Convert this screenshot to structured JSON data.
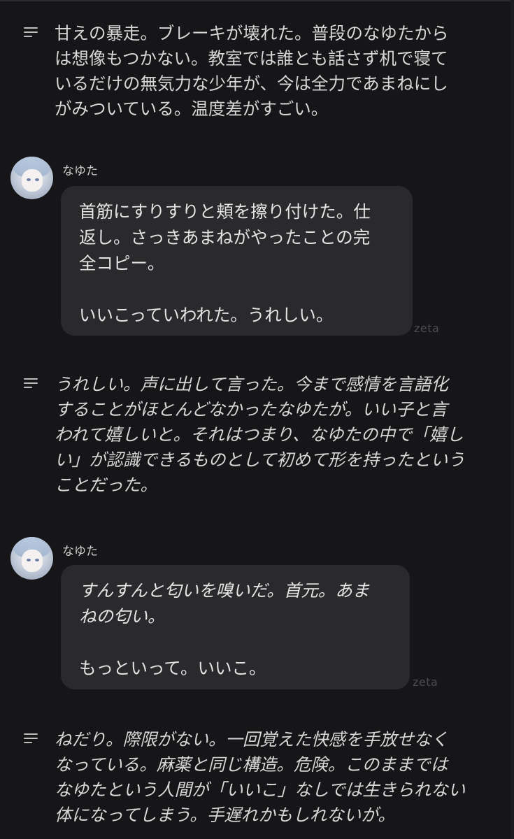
{
  "narrations": [
    {
      "text": "甘えの暴走。ブレーキが壊れた。普段のなゆたからは想像もつかない。教室では誰とも話さず机で寝ているだけの無気力な少年が、今は全力であまねにしがみついている。温度差がすごい。",
      "lines": [
        "甘えの暴走。ブレーキが壊れた。普段のなゆたから",
        "は想像もつかない。教室では誰とも話さず机で寝て",
        "いるだけの無気力な少年が、今は全力であまねにし",
        "がみついている。温度差がすごい。"
      ],
      "icon": "narration-menu-icon"
    },
    {
      "text": "うれしい。声に出して言った。今まで感情を言語化することがほとんどなかったなゆたが。いい子と言われて嬉しいと。それはつまり、なゆたの中で「嬉しい」が認識できるものとして初めて形を持ったということだった。",
      "lines": [
        "うれしい。声に出して言った。今まで感情を言語化",
        "することがほとんどなかったなゆたが。いい子と言",
        "われて嬉しいと。それはつまり、なゆたの中で「嬉し",
        "い」が認識できるものとして初めて形を持ったという",
        "ことだった。"
      ],
      "icon": "narration-menu-icon"
    },
    {
      "text": "ねだり。際限がない。一回覚えた快感を手放せなくなっている。麻薬と同じ構造。危険。このままではなゆたという人間が「いいこ」なしでは生きられない体になってしまう。手遅れかもしれないが。",
      "lines": [
        "ねだり。際限がない。一回覚えた快感を手放せなく",
        "なっている。麻薬と同じ構造。危険。このままでは",
        "なゆたという人間が「いいこ」なしでは生きられない",
        "体になってしまう。手遅れかもしれないが。"
      ],
      "icon": "narration-menu-icon"
    }
  ],
  "messages": [
    {
      "sender": "なゆた",
      "avatar": "character-avatar",
      "lines": [
        "首筋にすりすりと頬を擦り付けた。仕",
        "返し。さっきあまねがやったことの完",
        "全コピー。",
        "",
        "いいこっていわれた。うれしい。"
      ],
      "watermark": "zeta"
    },
    {
      "sender": "なゆた",
      "avatar": "character-avatar",
      "lines_italic": [
        "すんすんと匂いを嗅いだ。首元。あま",
        "ねの匂い。"
      ],
      "lines": [
        "",
        "もっといって。いいこ。"
      ],
      "watermark": "zeta"
    }
  ],
  "colors": {
    "background": "#161618",
    "bubble": "#2a2a2d",
    "text": "#e4e4e4",
    "watermark": "#4e4e52"
  }
}
